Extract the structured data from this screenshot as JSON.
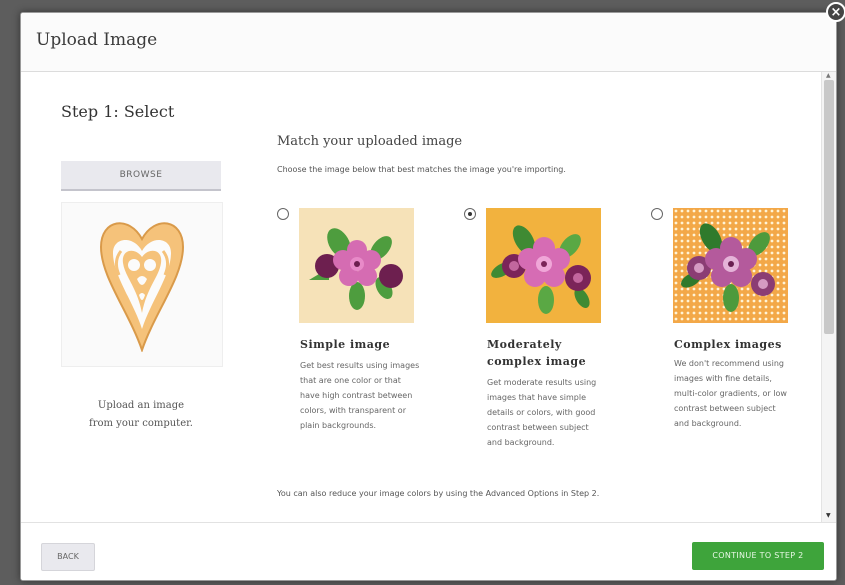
{
  "dialog": {
    "title": "Upload Image",
    "close_label": "×"
  },
  "left_panel": {
    "step_title": "Step 1: Select",
    "browse_label": "BROWSE",
    "upload_line1": "Upload an image",
    "upload_line2": "from your computer."
  },
  "match": {
    "title": "Match your uploaded image",
    "subtitle": "Choose the image below that best matches the image you're importing.",
    "options": [
      {
        "title_line1": "Simple image",
        "title_line2": "",
        "desc": [
          "Get best results using images",
          "that are one color or that",
          "have high contrast between",
          "colors, with transparent or",
          "plain backgrounds."
        ],
        "selected": false,
        "bg_color": "#f6e2b8"
      },
      {
        "title_line1": "Moderately",
        "title_line2": "complex image",
        "desc": [
          "Get moderate results using",
          "images that have simple",
          "details or colors, with good",
          "contrast between subject",
          "and background."
        ],
        "selected": true,
        "bg_color": "#f2b23e"
      },
      {
        "title_line1": "Complex images",
        "title_line2": "",
        "desc": [
          "We don't recommend using",
          "images with fine details,",
          "multi-color gradients, or low",
          "contrast between subject",
          "and background."
        ],
        "selected": false,
        "bg_color": "#f3a848"
      }
    ],
    "footnote": "You can also reduce your image colors by using the Advanced Options in Step 2."
  },
  "footer": {
    "back_label": "BACK",
    "continue_label": "CONTINUE TO STEP 2"
  },
  "colors": {
    "accent_green": "#3ea43b",
    "heart_fill": "#f5c27a",
    "flower_pink": "#d56cb2",
    "flower_dark": "#6d1f4f",
    "leaf_green": "#4e9d3e"
  }
}
